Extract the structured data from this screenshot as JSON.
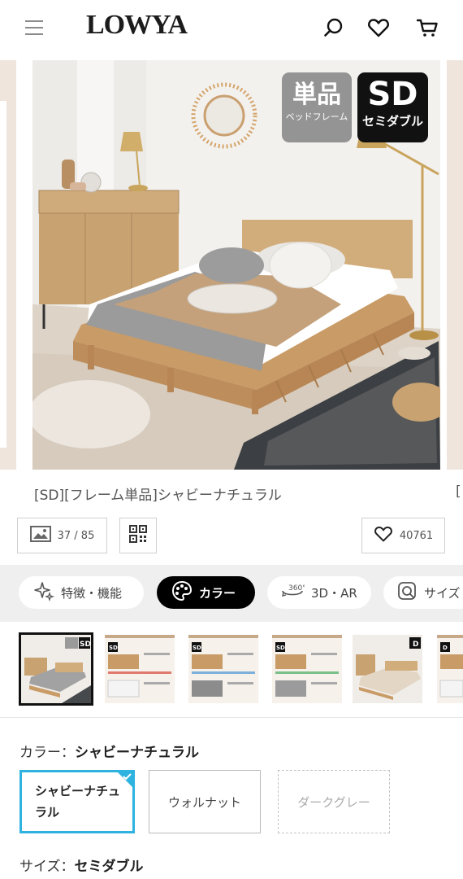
{
  "header": {
    "logo": "LOWYA",
    "menu_icon": "hamburger-menu-icon",
    "search_icon": "search-icon",
    "favorite_icon": "heart-icon",
    "cart_icon": "cart-icon"
  },
  "gallery": {
    "badge_single_main": "単品",
    "badge_single_sub": "ベッドフレーム",
    "badge_size_main": "SD",
    "badge_size_sub": "セミダブル",
    "product_title": "[SD][フレーム単品]シャビーナチュラル",
    "next_title_fragment": "[",
    "image_counter": "37 / 85",
    "favorite_count": "40761"
  },
  "tabs": [
    {
      "label": "特徴・機能",
      "icon": "sparkle-icon"
    },
    {
      "label": "カラー",
      "icon": "palette-icon"
    },
    {
      "label": "3D・AR",
      "icon": "360-icon"
    },
    {
      "label": "サイズ",
      "icon": "size-icon"
    }
  ],
  "thumbnails": [
    {
      "badge": "SD",
      "kind": "photo"
    },
    {
      "badge": "SD",
      "kind": "spec"
    },
    {
      "badge": "SD",
      "kind": "spec"
    },
    {
      "badge": "SD",
      "kind": "spec"
    },
    {
      "badge": "D",
      "kind": "photo"
    },
    {
      "badge": "D",
      "kind": "spec"
    }
  ],
  "color": {
    "label": "カラー：",
    "value": "シャビーナチュラル",
    "options": [
      {
        "label": "シャビーナチュラル",
        "state": "selected"
      },
      {
        "label": "ウォルナット",
        "state": "available"
      },
      {
        "label": "ダークグレー",
        "state": "unavailable"
      }
    ]
  },
  "size": {
    "label": "サイズ：",
    "value": "セミダブル"
  },
  "colors": {
    "accent_selected": "#2eb3e0",
    "active_tab": "#000000",
    "wood": "#c79a6a"
  }
}
